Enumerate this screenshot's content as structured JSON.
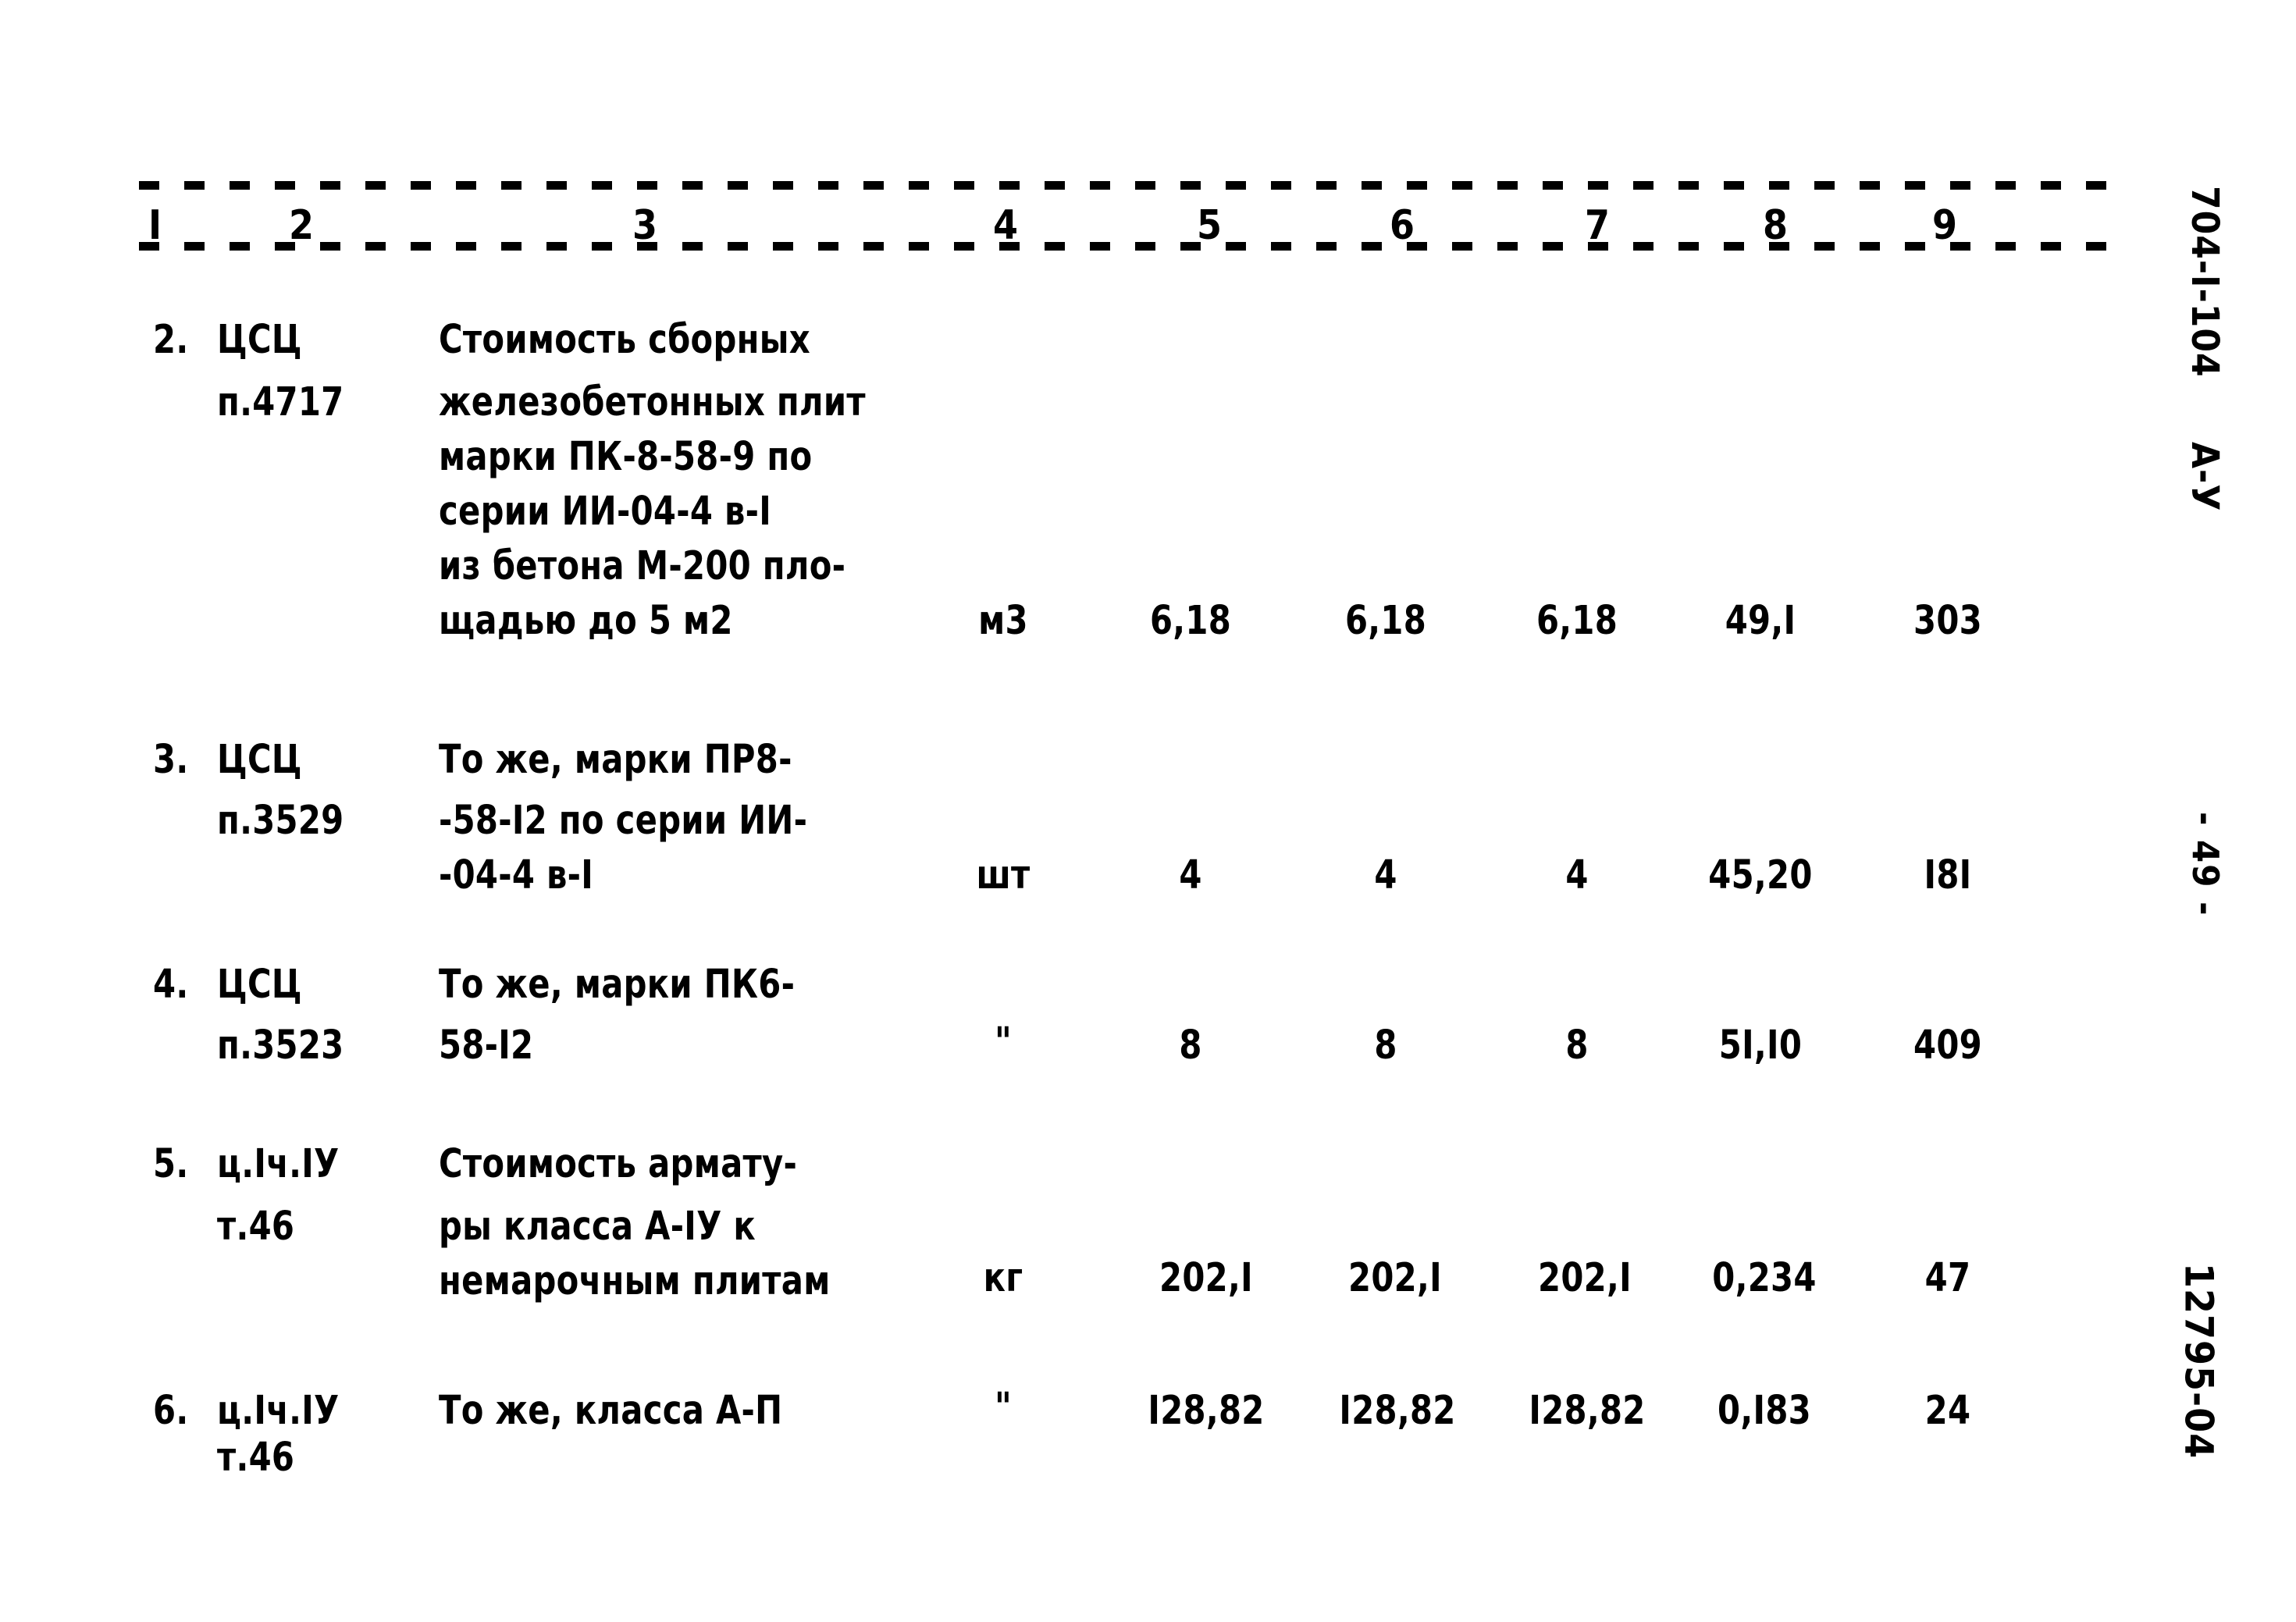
{
  "page": {
    "document_code": "704-I-104",
    "album_code": "А-У",
    "page_number": "- 49 -",
    "archive_code": "12795-04"
  },
  "table": {
    "column_headers": [
      "I",
      "2",
      "3",
      "4",
      "5",
      "6",
      "7",
      "8",
      "9"
    ],
    "rows": [
      {
        "number": "2.",
        "source_line1": "ЦСЦ",
        "source_line2": "п.4717",
        "description": [
          "Стоимость сборных",
          "железобетонных плит",
          "марки ПК-8-58-9 по",
          "серии ИИ-04-4 в-I",
          "из бетона М-200 пло-",
          "щадью до 5 м2"
        ],
        "unit": "м3",
        "col5": "6,18",
        "col6": "6,18",
        "col7": "6,18",
        "col8": "49,I",
        "col9": "303"
      },
      {
        "number": "3.",
        "source_line1": "ЦСЦ",
        "source_line2": "п.3529",
        "description": [
          "То же, марки ПР8-",
          "-58-I2 по серии ИИ-",
          "-04-4 в-I"
        ],
        "unit": "шт",
        "col5": "4",
        "col6": "4",
        "col7": "4",
        "col8": "45,20",
        "col9": "I8I"
      },
      {
        "number": "4.",
        "source_line1": "ЦСЦ",
        "source_line2": "п.3523",
        "description": [
          "То же, марки ПК6-",
          "58-I2"
        ],
        "unit": "\"",
        "col5": "8",
        "col6": "8",
        "col7": "8",
        "col8": "5I,I0",
        "col9": "409"
      },
      {
        "number": "5.",
        "source_line1": "ц.Iч.IУ",
        "source_line2": "т.46",
        "description": [
          "Стоимость армату-",
          "ры класса А-IУ к",
          "немарочным плитам"
        ],
        "unit": "кг",
        "col5": "202,I",
        "col6": "202,I",
        "col7": "202,I",
        "col8": "0,234",
        "col9": "47"
      },
      {
        "number": "6.",
        "source_line1": "ц.Iч.IУ",
        "source_line2": "т.46",
        "description": [
          "То же, класса А-П"
        ],
        "unit": "\"",
        "col5": "I28,82",
        "col6": "I28,82",
        "col7": "I28,82",
        "col8": "0,I83",
        "col9": "24"
      }
    ]
  }
}
